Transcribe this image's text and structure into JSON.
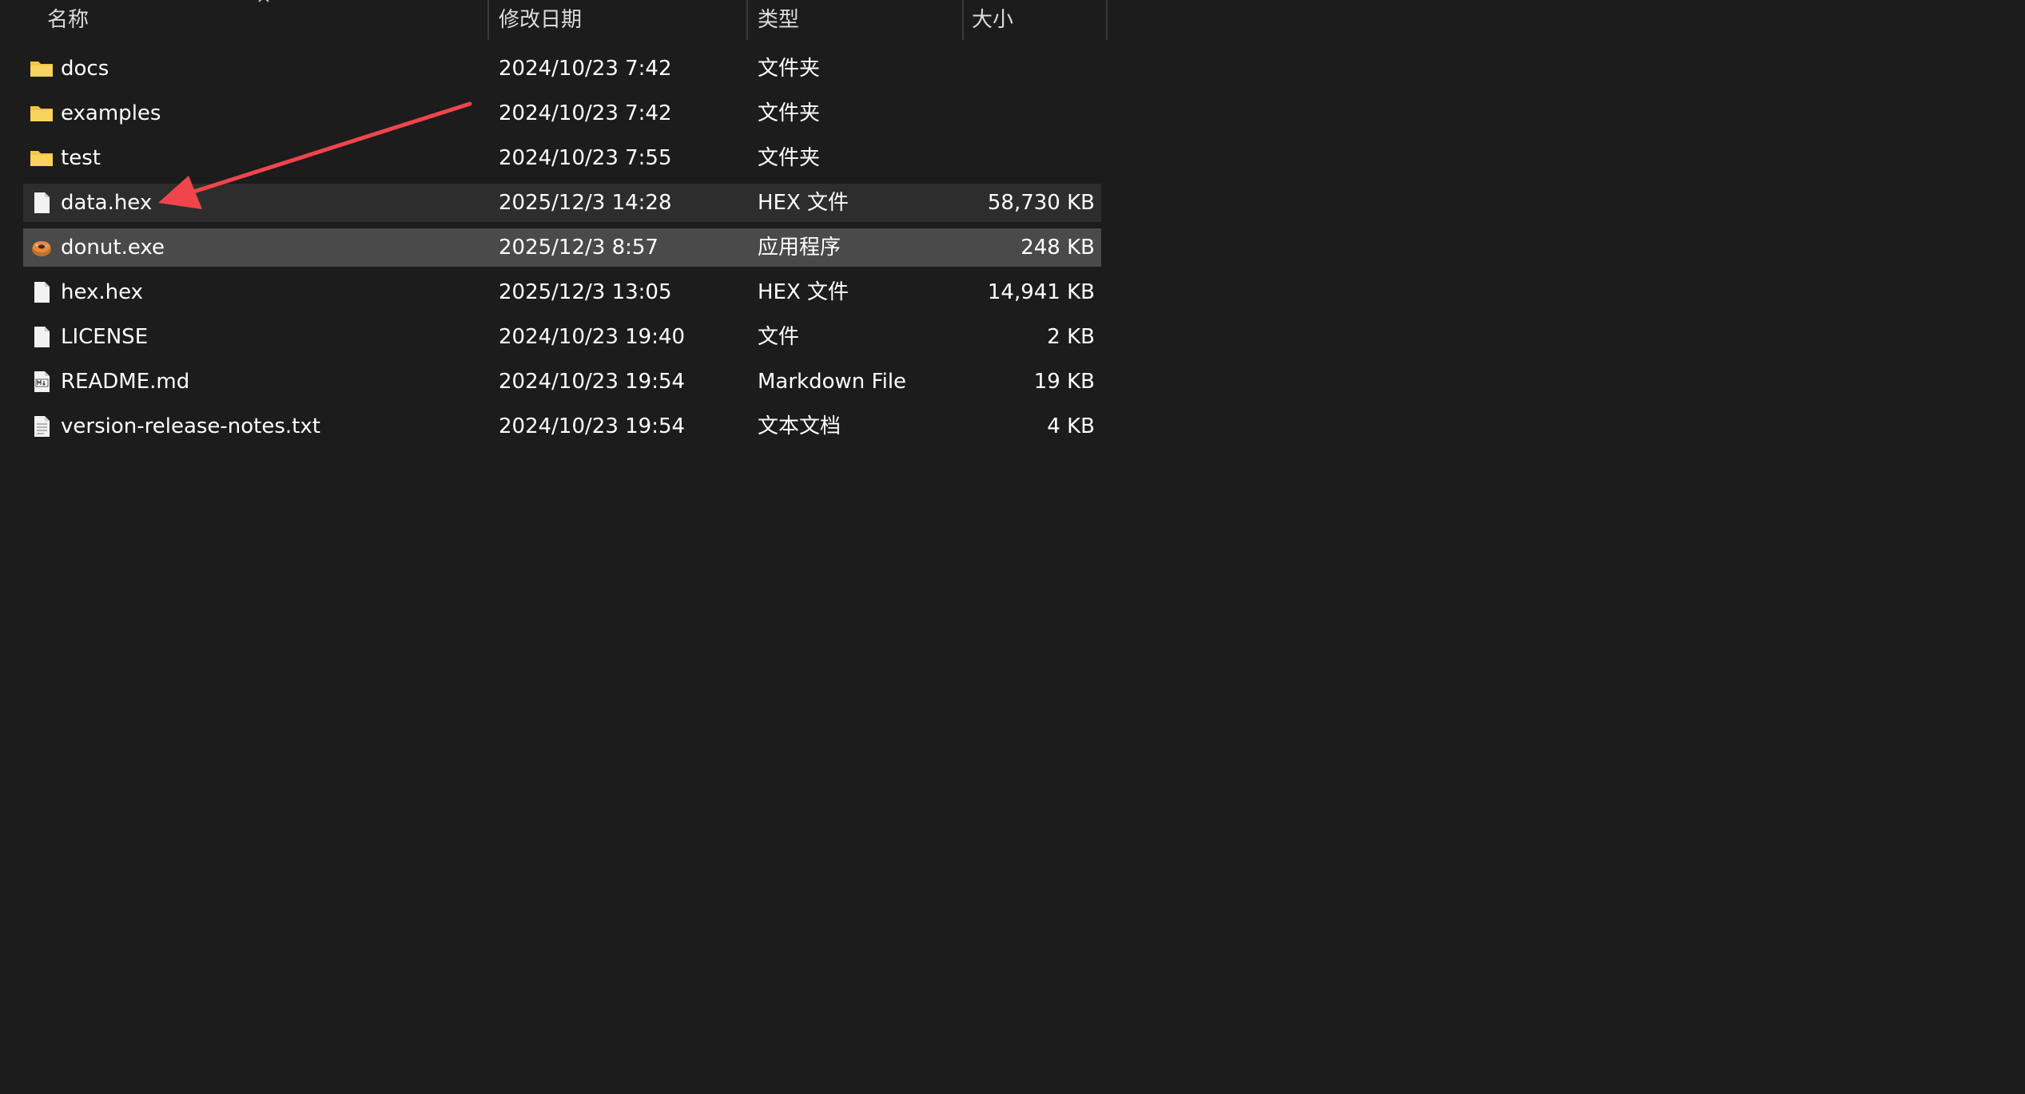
{
  "columns": {
    "name": "名称",
    "date": "修改日期",
    "type": "类型",
    "size": "大小"
  },
  "files": [
    {
      "name": "docs",
      "date": "2024/10/23 7:42",
      "type": "文件夹",
      "size": "",
      "icon": "folder-icon"
    },
    {
      "name": "examples",
      "date": "2024/10/23 7:42",
      "type": "文件夹",
      "size": "",
      "icon": "folder-icon"
    },
    {
      "name": "test",
      "date": "2024/10/23 7:55",
      "type": "文件夹",
      "size": "",
      "icon": "folder-icon"
    },
    {
      "name": "data.hex",
      "date": "2025/12/3 14:28",
      "type": "HEX 文件",
      "size": "58,730 KB",
      "icon": "file-icon"
    },
    {
      "name": "donut.exe",
      "date": "2025/12/3 8:57",
      "type": "应用程序",
      "size": "248 KB",
      "icon": "donut-app-icon"
    },
    {
      "name": "hex.hex",
      "date": "2025/12/3 13:05",
      "type": "HEX 文件",
      "size": "14,941 KB",
      "icon": "file-icon"
    },
    {
      "name": "LICENSE",
      "date": "2024/10/23 19:40",
      "type": "文件",
      "size": "2 KB",
      "icon": "file-icon"
    },
    {
      "name": "README.md",
      "date": "2024/10/23 19:54",
      "type": "Markdown File",
      "size": "19 KB",
      "icon": "markdown-file-icon"
    },
    {
      "name": "version-release-notes.txt",
      "date": "2024/10/23 19:54",
      "type": "文本文档",
      "size": "4 KB",
      "icon": "text-file-icon"
    }
  ],
  "colors": {
    "background": "#1c1c1c",
    "hover_row": "#2d2d2d",
    "selected_row": "#4a4a4a",
    "folder": "#f4c542",
    "annotation_arrow": "#f0454d"
  }
}
